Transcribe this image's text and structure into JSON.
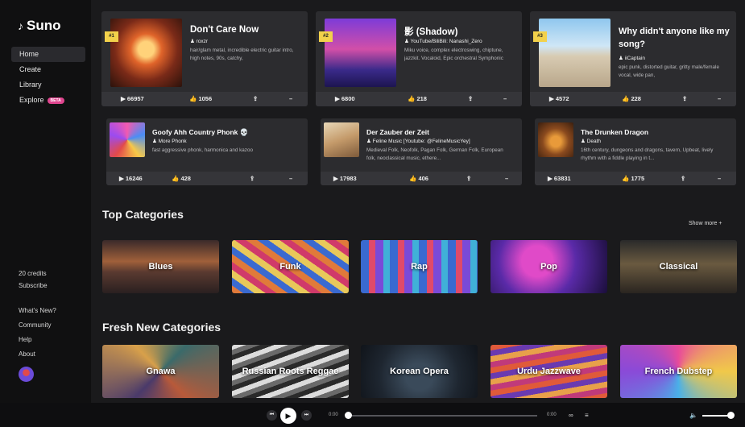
{
  "brand": {
    "name": "Suno",
    "icon": "music-note-icon"
  },
  "nav": [
    {
      "label": "Home",
      "active": true
    },
    {
      "label": "Create"
    },
    {
      "label": "Library"
    },
    {
      "label": "Explore",
      "badge": "BETA"
    }
  ],
  "sidebar_bottom": {
    "credits": "20 credits",
    "subscribe": "Subscribe",
    "whats_new": "What's New?",
    "community": "Community",
    "help": "Help",
    "about": "About"
  },
  "top_songs": [
    {
      "rank": "#1",
      "title": "Don't Care Now",
      "artist": "roxzr",
      "desc": "hair/glam metal, incredible electric guitar intro, high notes, 90s, catchy,",
      "plays": "66957",
      "likes": "1056"
    },
    {
      "rank": "#2",
      "title": "影 (Shadow)",
      "artist": "YouTube/BiliBili: Nanashi_Zero",
      "desc": "Miku voice, complex electroswing, chiptune, jazzkit. Vocaloid, Epic orchestral Symphonic",
      "plays": "6800",
      "likes": "218"
    },
    {
      "rank": "#3",
      "title": "Why didn't anyone like my song?",
      "artist": "iiCaptain",
      "desc": "epic punk, distorted guitar, gritty male/female vocal, wide pan,",
      "plays": "4572",
      "likes": "228"
    }
  ],
  "songs": [
    {
      "title": "Goofy Ahh Country Phonk 💀",
      "artist": "More Phonk",
      "desc": "fast aggressive phonk, harmonica and kazoo",
      "plays": "16246",
      "likes": "428"
    },
    {
      "title": "Der Zauber der Zeit",
      "artist": "Feline Music [Youtube: @FelineMusicYey]",
      "desc": "Medieval Folk, Neofolk, Pagan Folk, German Folk, European folk, neoclassical music, ethere...",
      "plays": "17983",
      "likes": "406"
    },
    {
      "title": "The Drunken Dragon",
      "artist": "Death",
      "desc": "16th century, dungeons and dragons, tavern, Upbeat, lively rhythm with a fiddle playing in t...",
      "plays": "63831",
      "likes": "1775"
    }
  ],
  "top_categories": {
    "title": "Top Categories",
    "show_more": "Show more +",
    "items": [
      "Blues",
      "Funk",
      "Rap",
      "Pop",
      "Classical"
    ]
  },
  "fresh_categories": {
    "title": "Fresh New Categories",
    "items": [
      "Gnawa",
      "Russian Roots Reggae",
      "Korean Opera",
      "Urdu Jazzwave",
      "French Dubstep"
    ]
  },
  "player": {
    "current_time": "0:00",
    "total_time": "0:00",
    "progress": 0,
    "volume": 0.85
  }
}
